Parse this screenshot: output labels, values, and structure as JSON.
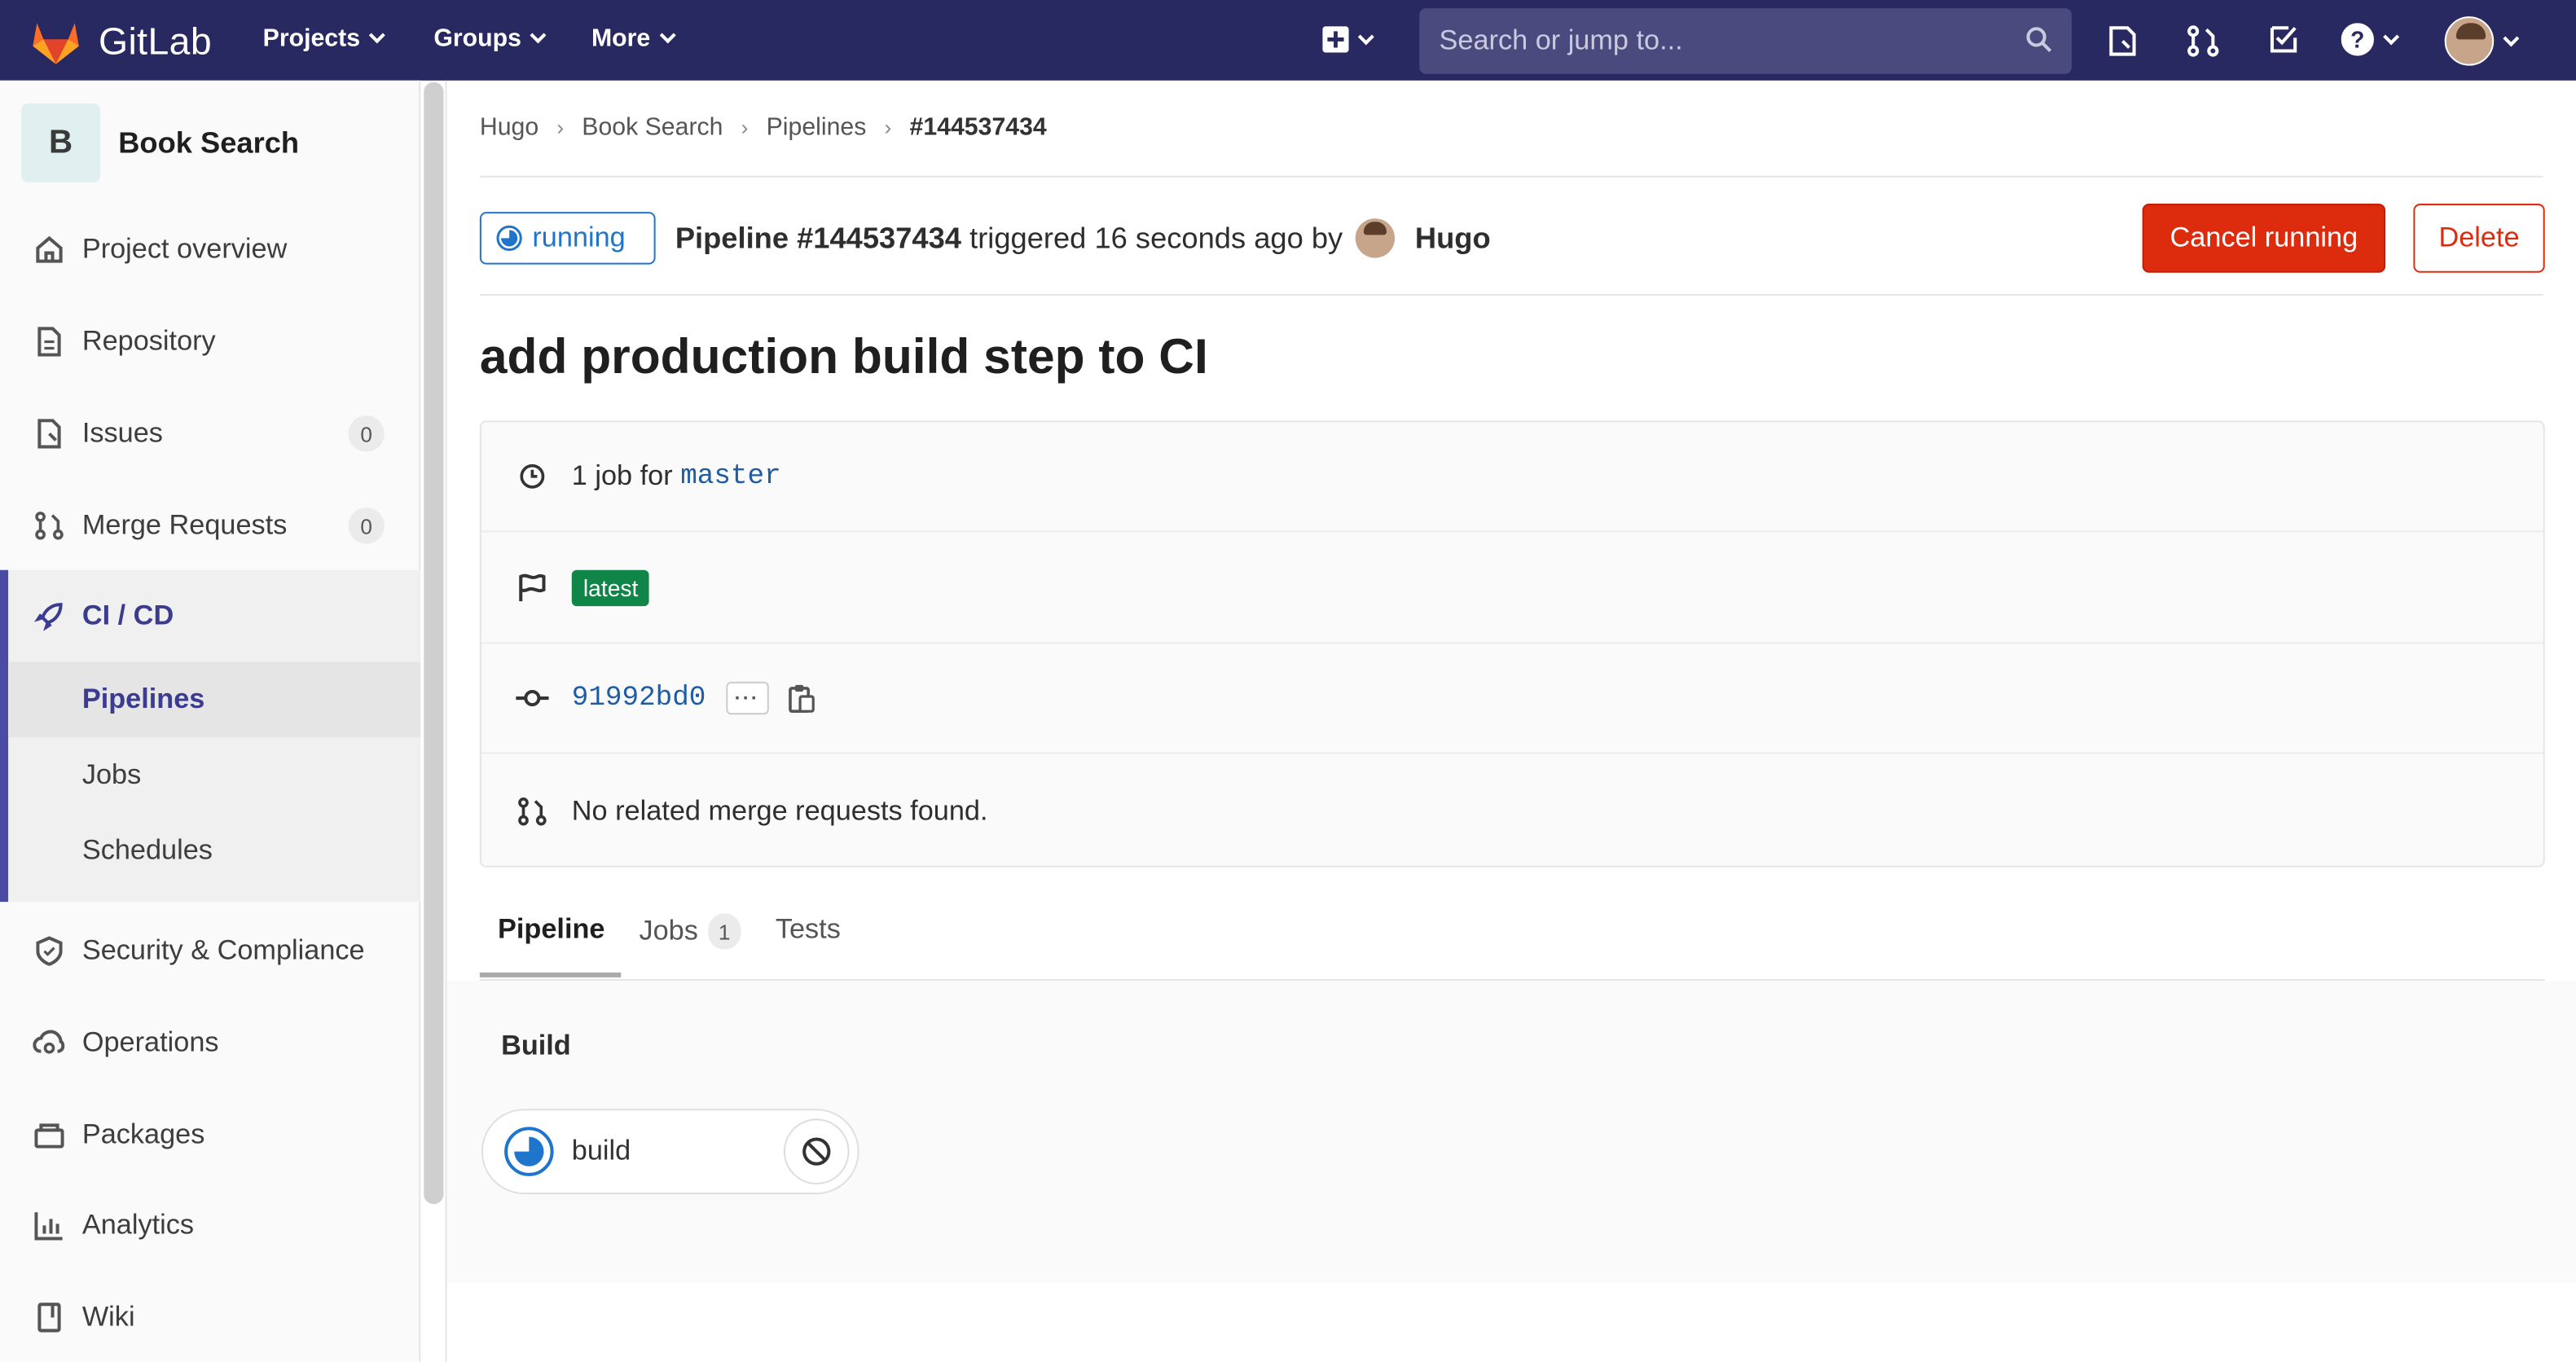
{
  "brand": {
    "name": "GitLab",
    "navbar_color": "#292961"
  },
  "topnav": {
    "projects": "Projects",
    "groups": "Groups",
    "more": "More",
    "search_placeholder": "Search or jump to..."
  },
  "sidebar": {
    "project_initial": "B",
    "project_name": "Book Search",
    "items": {
      "overview": "Project overview",
      "repository": "Repository",
      "issues": "Issues",
      "issues_count": "0",
      "merge_requests": "Merge Requests",
      "mr_count": "0",
      "cicd": "CI / CD",
      "pipelines": "Pipelines",
      "jobs": "Jobs",
      "schedules": "Schedules",
      "security": "Security & Compliance",
      "operations": "Operations",
      "packages": "Packages",
      "analytics": "Analytics",
      "wiki": "Wiki"
    }
  },
  "breadcrumb": [
    "Hugo",
    "Book Search",
    "Pipelines",
    "#144537434"
  ],
  "pipeline": {
    "status": "running",
    "label": "Pipeline #144537434",
    "triggered": "triggered 16 seconds ago by",
    "user": "Hugo",
    "cancel_label": "Cancel running",
    "delete_label": "Delete",
    "title": "add production build step to CI",
    "job_prefix": "1 job for",
    "branch": "master",
    "tag": "latest",
    "commit": "91992bd0",
    "mr_text": "No related merge requests found."
  },
  "tabs": {
    "pipeline": "Pipeline",
    "jobs": "Jobs",
    "jobs_count": "1",
    "tests": "Tests"
  },
  "graph": {
    "stage": "Build",
    "job": "build"
  },
  "colors": {
    "accent": "#1f75cb",
    "danger": "#dd2b0e",
    "success": "#108548",
    "active_nav": "#4b4ba3"
  }
}
